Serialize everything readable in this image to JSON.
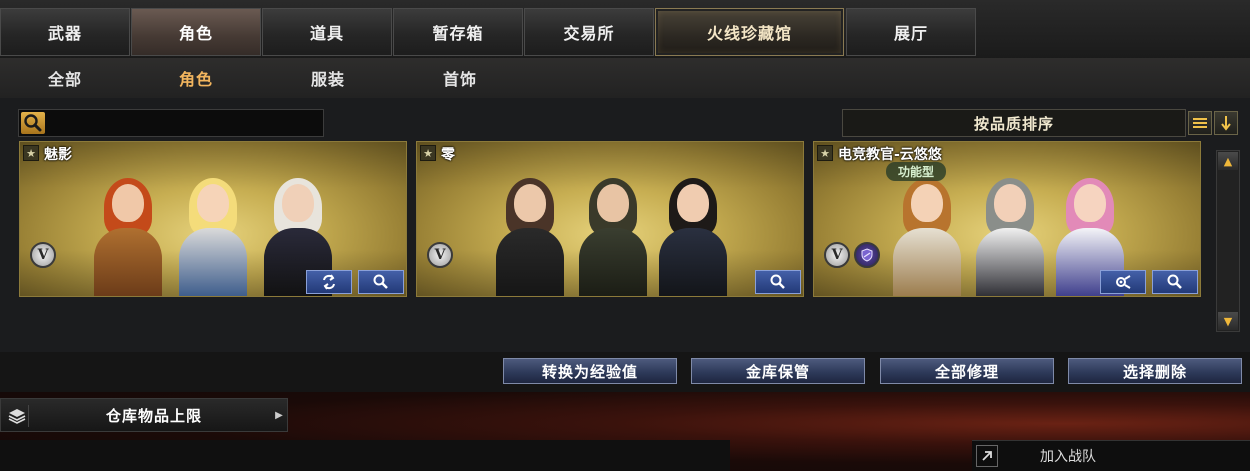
{
  "tabs": [
    {
      "label": "武器"
    },
    {
      "label": "角色"
    },
    {
      "label": "道具"
    },
    {
      "label": "暂存箱"
    },
    {
      "label": "交易所"
    },
    {
      "label": "火线珍藏馆"
    },
    {
      "label": "展厅"
    }
  ],
  "subtabs": [
    {
      "label": "全部"
    },
    {
      "label": "角色"
    },
    {
      "label": "服装"
    },
    {
      "label": "首饰"
    }
  ],
  "search": {
    "placeholder": ""
  },
  "sort": {
    "label": "按品质排序"
  },
  "cards": [
    {
      "name": "魅影",
      "v_badge": "V",
      "tag": ""
    },
    {
      "name": "零",
      "v_badge": "V",
      "tag": ""
    },
    {
      "name": "电竞教官-云悠悠",
      "v_badge": "V",
      "tag": "功能型"
    }
  ],
  "actions": [
    {
      "label": "转换为经验值"
    },
    {
      "label": "金库保管"
    },
    {
      "label": "全部修理"
    },
    {
      "label": "选择删除"
    }
  ],
  "footer": {
    "storage_label": "仓库物品上限",
    "join_label": "加入战队"
  },
  "colors": {
    "accent_subtab": "#f2b55e",
    "card_gold": "#c7ae52",
    "action_blue": "#2e3a5a"
  }
}
